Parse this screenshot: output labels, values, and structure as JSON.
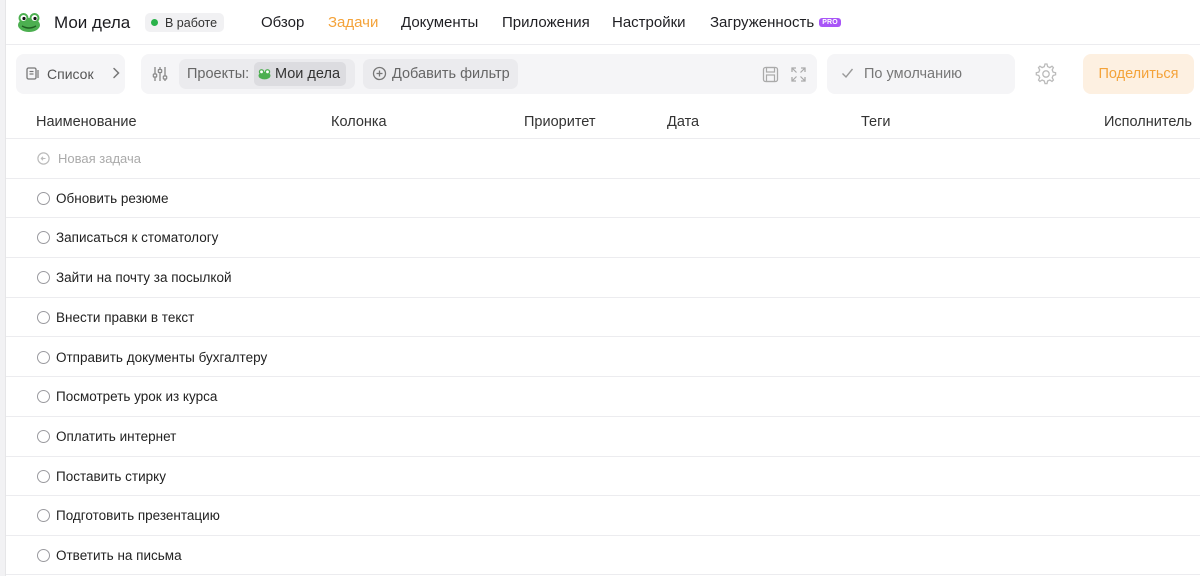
{
  "header": {
    "project_title": "Мои дела",
    "status": "В работе",
    "nav": {
      "overview": "Обзор",
      "tasks": "Задачи",
      "documents": "Документы",
      "apps": "Приложения",
      "settings": "Настройки",
      "workload": "Загруженность",
      "pro": "PRO"
    }
  },
  "toolbar": {
    "view_label": "Список",
    "projects_label": "Проекты:",
    "project_chip": "Мои дела",
    "add_filter": "Добавить фильтр",
    "sort_label": "По умолчанию",
    "share": "Поделиться"
  },
  "table": {
    "columns": {
      "name": "Наименование",
      "column": "Колонка",
      "priority": "Приоритет",
      "date": "Дата",
      "tags": "Теги",
      "assignee": "Исполнитель"
    },
    "new_task": "Новая задача",
    "tasks": [
      "Обновить резюме",
      "Записаться к стоматологу",
      "Зайти на почту за посылкой",
      "Внести правки в текст",
      "Отправить документы бухгалтеру",
      "Посмотреть урок из курса",
      "Оплатить интернет",
      "Поставить стирку",
      "Подготовить презентацию",
      "Ответить на письма"
    ]
  },
  "colors": {
    "accent": "#f4a33a",
    "status_green": "#2ab24a",
    "pro_purple": "#a855f7"
  }
}
